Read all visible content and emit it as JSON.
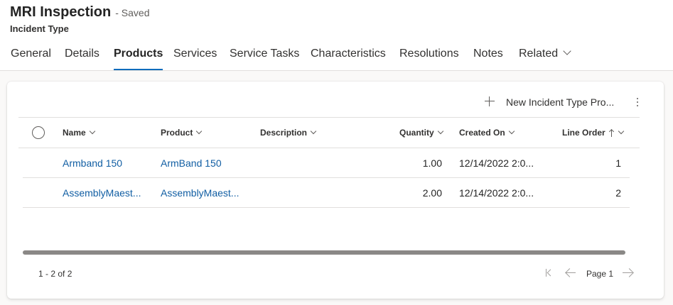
{
  "header": {
    "title": "MRI Inspection",
    "save_status": "- Saved",
    "entity": "Incident Type"
  },
  "tabs": [
    {
      "label": "General"
    },
    {
      "label": "Details"
    },
    {
      "label": "Products",
      "active": true
    },
    {
      "label": "Services"
    },
    {
      "label": "Service Tasks"
    },
    {
      "label": "Characteristics"
    },
    {
      "label": "Resolutions"
    },
    {
      "label": "Notes"
    },
    {
      "label": "Related"
    }
  ],
  "commands": {
    "new_label": "New Incident Type Pro..."
  },
  "grid": {
    "columns": [
      "Name",
      "Product",
      "Description",
      "Quantity",
      "Created On",
      "Line Order"
    ],
    "rows": [
      {
        "name": "Armband 150",
        "product": "ArmBand 150",
        "description": "",
        "quantity": "1.00",
        "created_on": "12/14/2022 2:0...",
        "line_order": "1"
      },
      {
        "name": "AssemblyMaest...",
        "product": "AssemblyMaest...",
        "description": "",
        "quantity": "2.00",
        "created_on": "12/14/2022 2:0...",
        "line_order": "2"
      }
    ]
  },
  "footer": {
    "count": "1 - 2 of 2",
    "page": "Page 1"
  },
  "colors": {
    "accent": "#0f6cbd",
    "link": "#115ea3"
  }
}
